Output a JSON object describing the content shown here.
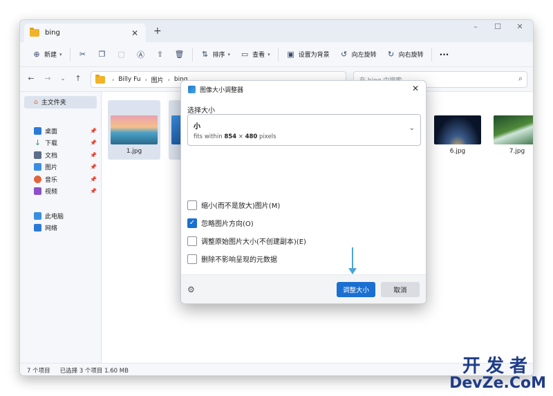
{
  "tab": {
    "title": "bing",
    "close": "✕",
    "new_tab": "+"
  },
  "window_controls": {
    "minimize": "–",
    "maximize": "☐",
    "close": "✕"
  },
  "toolbar": {
    "new_label": "新建",
    "sort_label": "排序",
    "view_label": "查看",
    "set_background": "设置为背景",
    "rotate_left": "向左旋转",
    "rotate_right": "向右旋转",
    "more": "···"
  },
  "address": {
    "crumbs": [
      "Billy Fu",
      "图片",
      "bing"
    ],
    "search_placeholder": "在 bing 中搜索"
  },
  "sidebar": {
    "home": "主文件夹",
    "items": [
      {
        "label": "桌面",
        "color": "#2b7bd6"
      },
      {
        "label": "下载",
        "color": "#2c9c5a"
      },
      {
        "label": "文档",
        "color": "#5b6e8a"
      },
      {
        "label": "图片",
        "color": "#3a8ee0"
      },
      {
        "label": "音乐",
        "color": "#e0653a"
      },
      {
        "label": "视频",
        "color": "#8e4fc8"
      }
    ],
    "pc": "此电脑",
    "network": "网络"
  },
  "files": [
    {
      "name": "1.jpg"
    },
    {
      "name": "6.jpg"
    },
    {
      "name": "7.jpg"
    }
  ],
  "status": {
    "count": "7 个项目",
    "selected": "已选择 3 个项目 1.60 MB"
  },
  "dialog": {
    "title": "图像大小调整器",
    "close": "✕",
    "select_size_label": "选择大小",
    "size_name": "小",
    "size_prefix": "fits within ",
    "size_w": "854",
    "size_x": " × ",
    "size_h": "480",
    "size_unit": " pixels",
    "options": [
      {
        "label": "缩小(而不是放大)图片(M)",
        "checked": false
      },
      {
        "label": "忽略图片方向(O)",
        "checked": true
      },
      {
        "label": "调整原始图片大小(不创建副本)(E)",
        "checked": false
      },
      {
        "label": "删除不影响呈现的元数据",
        "checked": false
      }
    ],
    "resize_button": "调整大小",
    "cancel_button": "取消"
  },
  "watermark": {
    "top": "开发者",
    "bottom": "DevZe.CoM"
  }
}
